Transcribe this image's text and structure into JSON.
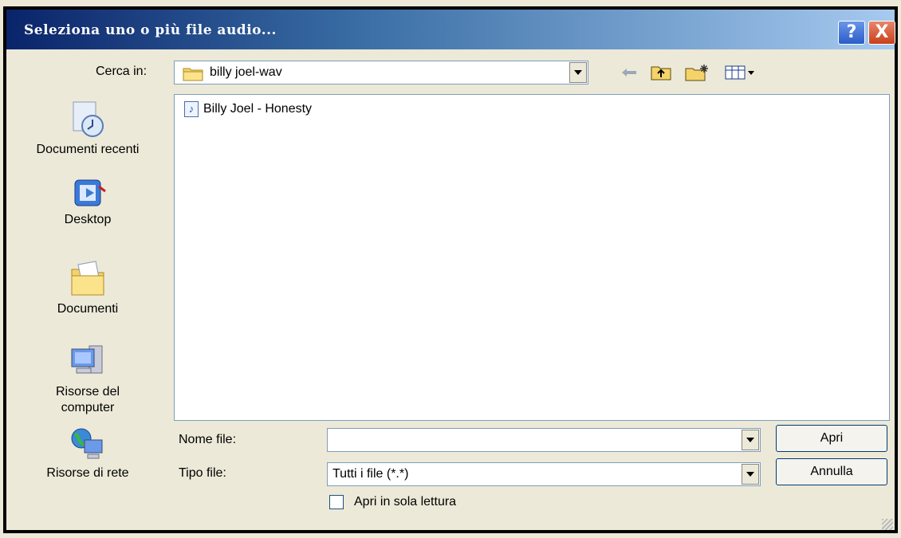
{
  "window": {
    "title": "Seleziona uno o più file audio...",
    "help_label": "?",
    "close_label": "X"
  },
  "lookin": {
    "label": "Cerca in:",
    "value": "billy joel-wav"
  },
  "toolbar": {
    "back_icon": "back-arrow-icon",
    "up_icon": "up-folder-icon",
    "newfolder_icon": "new-folder-icon",
    "views_icon": "views-menu-icon"
  },
  "places": [
    {
      "label": "Documenti recenti",
      "icon": "recent-documents-icon"
    },
    {
      "label": "Desktop",
      "icon": "desktop-icon"
    },
    {
      "label": "Documenti",
      "icon": "documents-folder-icon"
    },
    {
      "label": "Risorse del computer",
      "icon": "my-computer-icon"
    },
    {
      "label": "Risorse di rete",
      "icon": "network-icon"
    }
  ],
  "files": [
    {
      "name": "Billy Joel - Honesty",
      "icon": "audio-file-icon"
    }
  ],
  "filename": {
    "label": "Nome file:",
    "value": ""
  },
  "filetype": {
    "label": "Tipo file:",
    "value": "Tutti i file (*.*)"
  },
  "buttons": {
    "open": "Apri",
    "cancel": "Annulla"
  },
  "readonly": {
    "label": "Apri in sola lettura",
    "checked": false
  }
}
